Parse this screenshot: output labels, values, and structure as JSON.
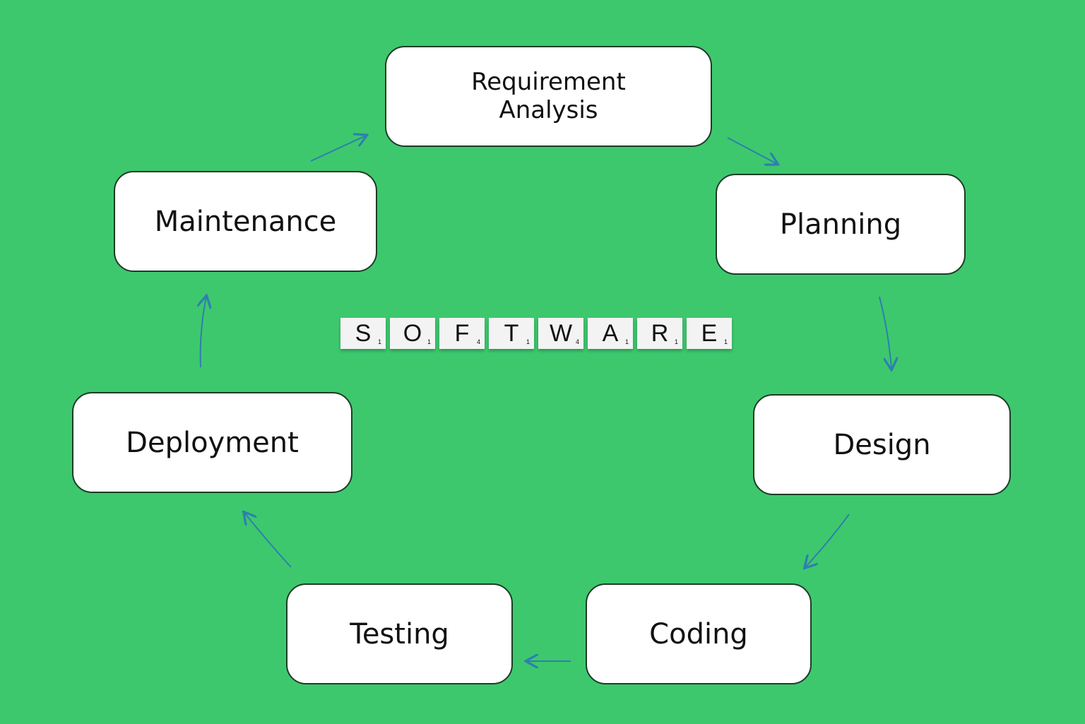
{
  "diagram": {
    "nodes": [
      {
        "id": "requirement-analysis",
        "label": "Requirement\nAnalysis"
      },
      {
        "id": "planning",
        "label": "Planning"
      },
      {
        "id": "design",
        "label": "Design"
      },
      {
        "id": "coding",
        "label": "Coding"
      },
      {
        "id": "testing",
        "label": "Testing"
      },
      {
        "id": "deployment",
        "label": "Deployment"
      },
      {
        "id": "maintenance",
        "label": "Maintenance"
      }
    ],
    "edges": [
      [
        "requirement-analysis",
        "planning"
      ],
      [
        "planning",
        "design"
      ],
      [
        "design",
        "coding"
      ],
      [
        "coding",
        "testing"
      ],
      [
        "testing",
        "deployment"
      ],
      [
        "deployment",
        "maintenance"
      ],
      [
        "maintenance",
        "requirement-analysis"
      ]
    ],
    "center_tiles": [
      {
        "letter": "S",
        "points": "1"
      },
      {
        "letter": "O",
        "points": "1"
      },
      {
        "letter": "F",
        "points": "4"
      },
      {
        "letter": "T",
        "points": "1"
      },
      {
        "letter": "W",
        "points": "4"
      },
      {
        "letter": "A",
        "points": "1"
      },
      {
        "letter": "R",
        "points": "1"
      },
      {
        "letter": "E",
        "points": "1"
      }
    ],
    "colors": {
      "background": "#3dc86e",
      "arrow": "#2f7fae",
      "box": "#ffffff"
    }
  }
}
